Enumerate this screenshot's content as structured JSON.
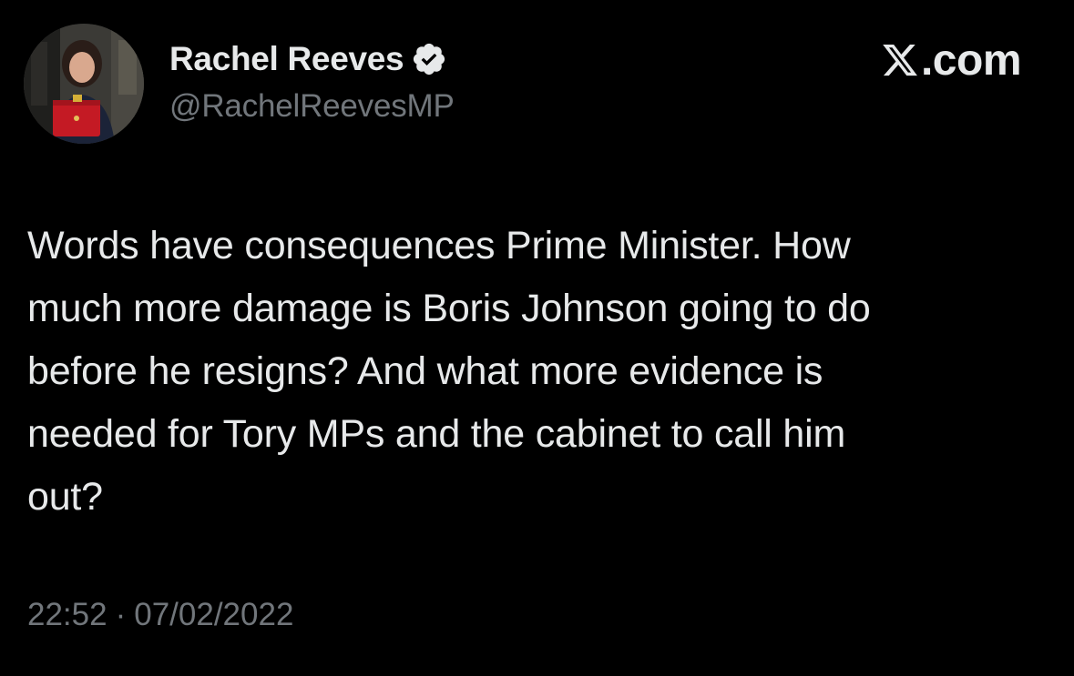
{
  "author": {
    "display_name": "Rachel Reeves",
    "handle": "@RachelReevesMP",
    "verified": true,
    "avatar_icon": "profile-photo"
  },
  "brand": {
    "icon": "x-logo-icon",
    "text": ".com"
  },
  "tweet": {
    "text": "Words have consequences Prime Minister. How\nmuch more damage is Boris Johnson going to do\nbefore he resigns? And what more evidence is\nneeded for Tory MPs and the cabinet to call him\nout?",
    "time": "22:52",
    "separator": "·",
    "date": "07/02/2022"
  },
  "colors": {
    "background": "#000000",
    "primary_text": "#e7e9ea",
    "secondary_text": "#71767b",
    "verified_badge": "#e7e9ea"
  }
}
